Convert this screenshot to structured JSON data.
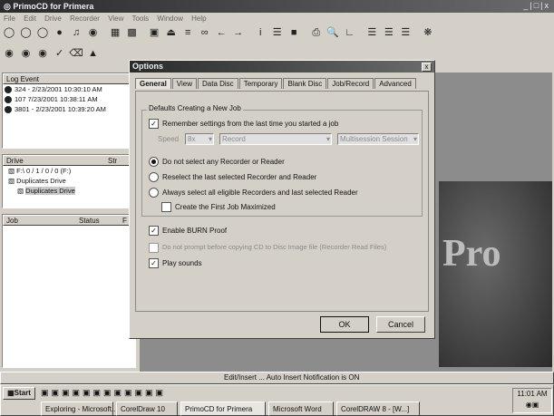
{
  "window": {
    "title": "PrimoCD for Primera",
    "controls": "_|&#9633;|x"
  },
  "menu": [
    "File",
    "Edit",
    "Drive",
    "Recorder",
    "View",
    "Tools",
    "Window",
    "Help"
  ],
  "log": {
    "header": "Log Event",
    "rows": [
      "324 - 2/23/2001 10:30:10 AM",
      "107 7/23/2001 10:38:11 AM",
      "3801 - 2/23/2001 10:39:20 AM"
    ]
  },
  "drives": {
    "header": "Drive",
    "header2": "Str",
    "items": [
      "F:\\ 0 / 1 / 0 / 0 (F:)",
      "Duplicates Drive",
      "Duplicates Drive"
    ]
  },
  "jobs": {
    "col_job": "Job",
    "col_status": "Status",
    "col_extra": "F"
  },
  "splash": {
    "text": "Pro"
  },
  "status_bar": {
    "text": "Edit/Insert ... Auto Insert Notification is ON"
  },
  "dialog": {
    "title": "Options",
    "tabs": [
      "General",
      "View",
      "Data Disc",
      "Temporary",
      "Blank Disc",
      "Job/Record",
      "Advanced"
    ],
    "group_label": "Defaults Creating a New Job",
    "remember": "Remember settings from the last time you started a job",
    "speed_label": "Speed",
    "speed_value": "8x",
    "mode_value": "Record",
    "extra_value": "Multisession Session",
    "radio1": "Do not select any Recorder or Reader",
    "radio2": "Reselect the last selected Recorder and Reader",
    "radio3": "Always select all eligible Recorders and last selected Reader",
    "sub_check": "Create the First Job Maximized",
    "burnproof": "Enable BURN Proof",
    "disabled_opt": "Do not prompt before copying CD to Disc Image file (Recorder Read Files)",
    "playsounds": "Play sounds",
    "ok": "OK",
    "cancel": "Cancel"
  },
  "taskbar": {
    "start": "Start",
    "time": "11:01 AM",
    "tasks": [
      "Exploring - Microsoft...",
      "CorelDraw 10",
      "PrimoCD for Primera",
      "Microsoft Word",
      "CorelDRAW 8 - [W...]"
    ]
  },
  "colors": {
    "titlebar": "#2a2a2a",
    "face": "#d4d0c8",
    "splash": "#3a3a3a"
  }
}
